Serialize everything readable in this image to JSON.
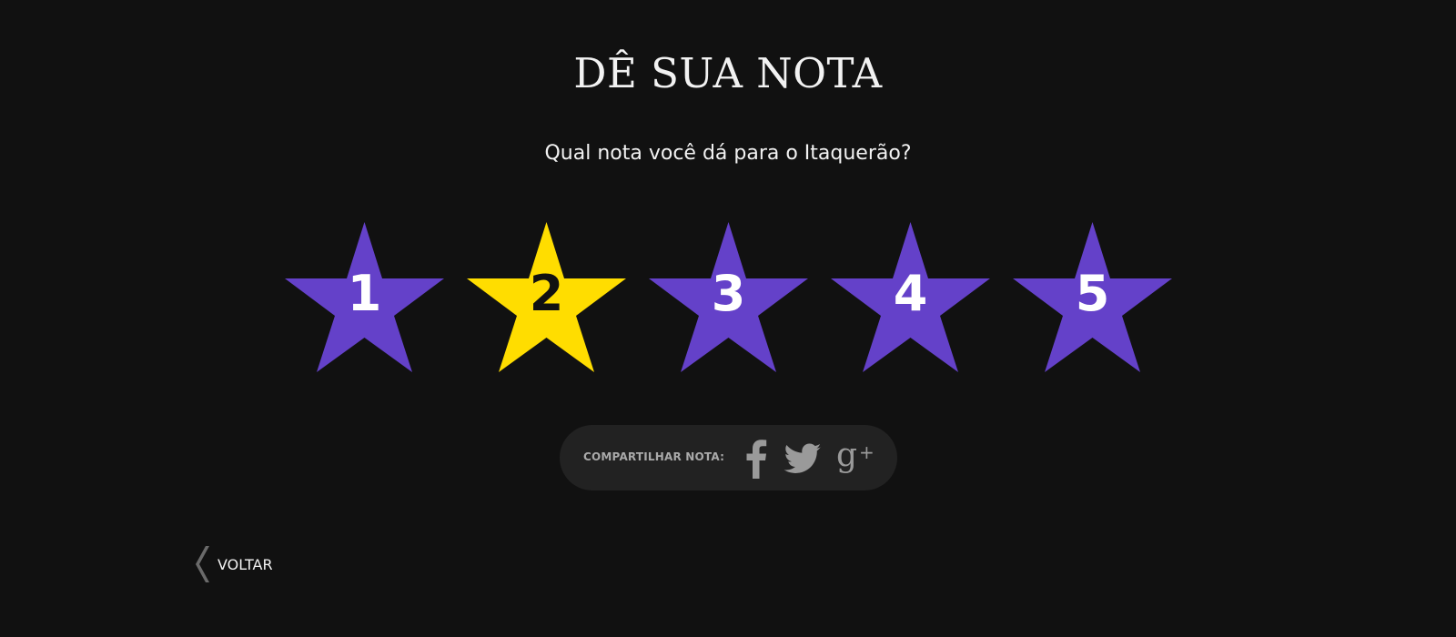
{
  "header": {
    "title": "DÊ SUA NOTA",
    "question": "Qual nota você dá para o Itaquerão?"
  },
  "rating": {
    "selected": 2,
    "max": 5,
    "stars": [
      {
        "label": "1",
        "selected": false
      },
      {
        "label": "2",
        "selected": true
      },
      {
        "label": "3",
        "selected": false
      },
      {
        "label": "4",
        "selected": false
      },
      {
        "label": "5",
        "selected": false
      }
    ]
  },
  "share": {
    "label": "COMPARTILHAR NOTA:",
    "icons": [
      "facebook-icon",
      "twitter-icon",
      "google-plus-icon"
    ]
  },
  "back": {
    "label": "VOLTAR"
  },
  "colors": {
    "background": "#111111",
    "star_default": "#6441c9",
    "star_selected": "#ffdd00",
    "star_number_default": "#ffffff",
    "star_number_selected": "#111111",
    "share_pill": "#222222",
    "icon_gray": "#9a9a9a"
  }
}
